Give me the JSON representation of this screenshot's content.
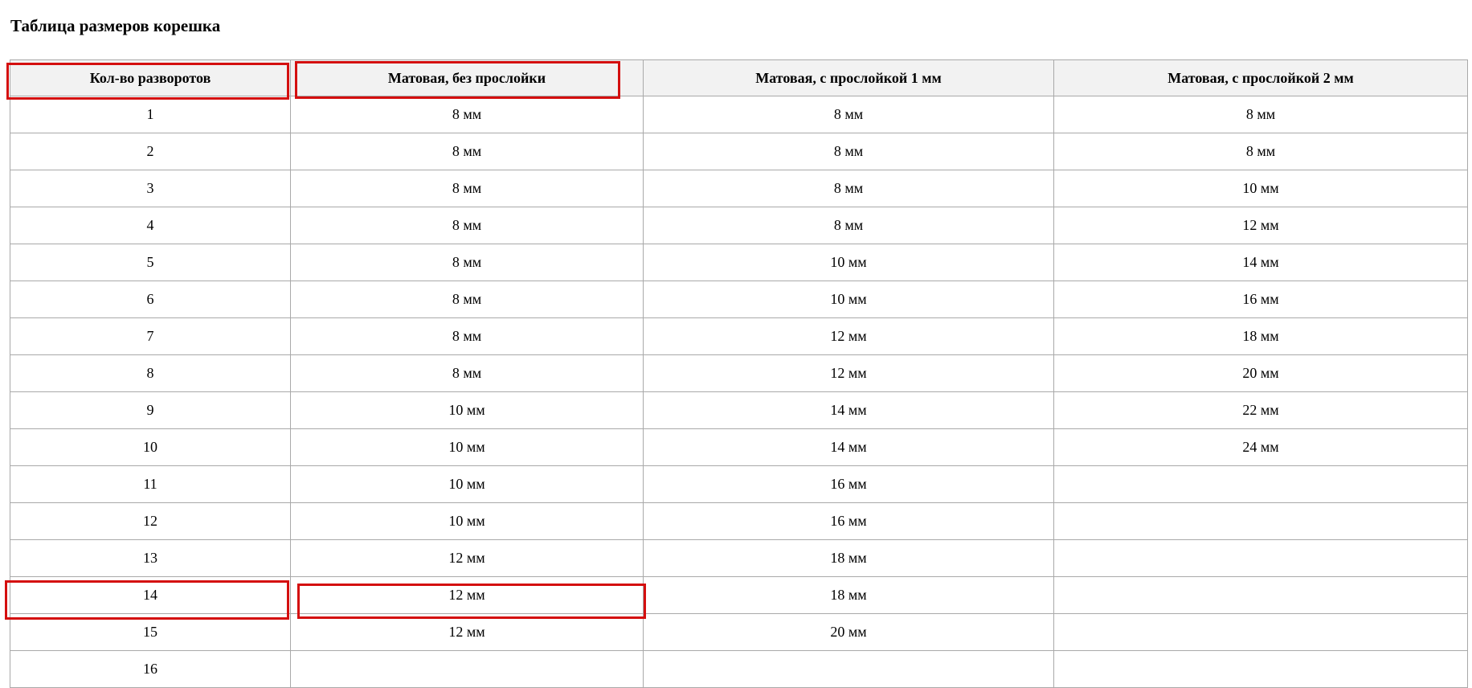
{
  "page": {
    "title": "Таблица размеров корешка"
  },
  "table": {
    "headers": [
      "Кол-во разворотов",
      "Матовая, без прослойки",
      "Матовая, с прослойкой 1 мм",
      "Матовая, с прослойкой 2 мм"
    ],
    "rows": [
      [
        "1",
        "8 мм",
        "8 мм",
        "8 мм"
      ],
      [
        "2",
        "8 мм",
        "8 мм",
        "8 мм"
      ],
      [
        "3",
        "8 мм",
        "8 мм",
        "10 мм"
      ],
      [
        "4",
        "8 мм",
        "8 мм",
        "12 мм"
      ],
      [
        "5",
        "8 мм",
        "10 мм",
        "14 мм"
      ],
      [
        "6",
        "8 мм",
        "10 мм",
        "16 мм"
      ],
      [
        "7",
        "8 мм",
        "12 мм",
        "18 мм"
      ],
      [
        "8",
        "8 мм",
        "12 мм",
        "20 мм"
      ],
      [
        "9",
        "10 мм",
        "14 мм",
        "22 мм"
      ],
      [
        "10",
        "10 мм",
        "14 мм",
        "24 мм"
      ],
      [
        "11",
        "10 мм",
        "16 мм",
        ""
      ],
      [
        "12",
        "10 мм",
        "16 мм",
        ""
      ],
      [
        "13",
        "12 мм",
        "18 мм",
        ""
      ],
      [
        "14",
        "12 мм",
        "18 мм",
        ""
      ],
      [
        "15",
        "12 мм",
        "20 мм",
        ""
      ],
      [
        "16",
        "",
        "",
        ""
      ]
    ]
  },
  "highlight_color": "#d40f0f"
}
